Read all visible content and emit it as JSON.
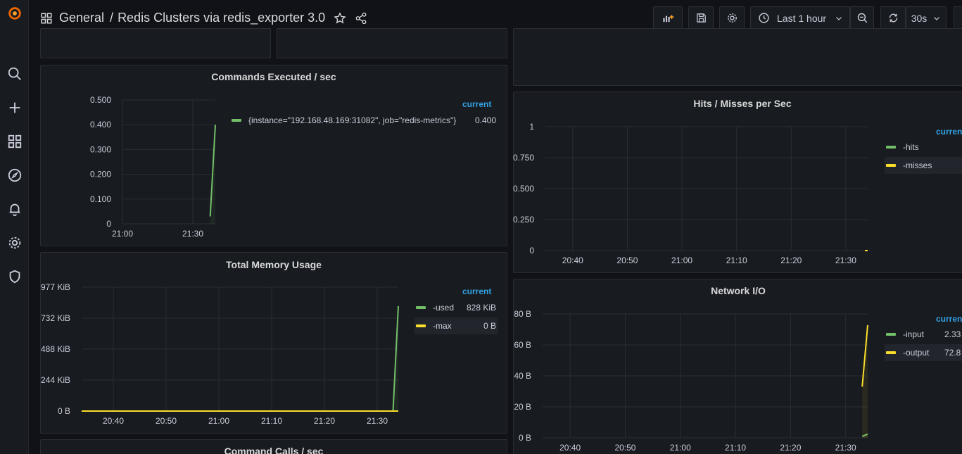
{
  "colors": {
    "green": "#73bf69",
    "yellow": "#fade2a",
    "blue": "#33a2e5",
    "background": "#111217",
    "panel": "#181b1f"
  },
  "sidebar": {
    "items": [
      {
        "name": "grafana-logo",
        "icon": "grafana-logo"
      },
      {
        "name": "search",
        "icon": "search-icon"
      },
      {
        "name": "create",
        "icon": "plus-icon"
      },
      {
        "name": "dashboards",
        "icon": "apps-icon"
      },
      {
        "name": "explore",
        "icon": "compass-icon"
      },
      {
        "name": "alerting",
        "icon": "bell-icon"
      },
      {
        "name": "configuration",
        "icon": "gear-icon"
      },
      {
        "name": "server-admin",
        "icon": "shield-icon"
      }
    ]
  },
  "header": {
    "folder": "General",
    "separator": "/",
    "title": "Redis Clusters via redis_exporter 3.0",
    "time_range": "Last 1 hour",
    "refresh": "30s"
  },
  "panels": {
    "commands": {
      "title": "Commands Executed / sec",
      "legend_header": "current",
      "legend": [
        {
          "name": "{instance=\"192.168.48.169:31082\", job=\"redis-metrics\"}",
          "value": "0.400",
          "color": "#73bf69"
        }
      ]
    },
    "memory": {
      "title": "Total Memory Usage",
      "legend_header": "current",
      "legend": [
        {
          "name": "-used",
          "value": "828 KiB",
          "color": "#73bf69"
        },
        {
          "name": "-max",
          "value": "0 B",
          "color": "#fade2a"
        }
      ]
    },
    "hits": {
      "title": "Hits / Misses per Sec",
      "legend_header": "current",
      "legend": [
        {
          "name": "-hits",
          "value": "",
          "color": "#73bf69"
        },
        {
          "name": "-misses",
          "value": "",
          "color": "#fade2a"
        }
      ]
    },
    "network": {
      "title": "Network I/O",
      "legend_header": "current",
      "legend": [
        {
          "name": "-input",
          "value": "2.33",
          "color": "#73bf69"
        },
        {
          "name": "-output",
          "value": "72.8",
          "color": "#fade2a"
        }
      ]
    },
    "command_calls": {
      "title": "Command Calls / sec"
    }
  },
  "chart_data": [
    {
      "panel": "Commands Executed / sec",
      "type": "line",
      "y_ticks": [
        "0.500",
        "0.400",
        "0.300",
        "0.200",
        "0.100",
        "0"
      ],
      "x_ticks": [
        "21:00",
        "21:30"
      ],
      "ylim": [
        0,
        0.5
      ],
      "series": [
        {
          "name": "{instance=\"192.168.48.169:31082\", job=\"redis-metrics\"}",
          "color": "#73bf69",
          "x": [
            "21:31",
            "21:34"
          ],
          "y": [
            0.03,
            0.4
          ]
        }
      ]
    },
    {
      "panel": "Total Memory Usage",
      "type": "line",
      "y_ticks": [
        "977 KiB",
        "732 KiB",
        "488 KiB",
        "244 KiB",
        "0 B"
      ],
      "x_ticks": [
        "20:40",
        "20:50",
        "21:00",
        "21:10",
        "21:20",
        "21:30"
      ],
      "ylim": [
        0,
        977
      ],
      "series": [
        {
          "name": "-used",
          "color": "#73bf69",
          "x": [
            "21:33",
            "21:34"
          ],
          "y": [
            0,
            828
          ]
        },
        {
          "name": "-max",
          "color": "#fade2a",
          "x": [
            "20:34",
            "21:34"
          ],
          "y": [
            0,
            0
          ]
        }
      ]
    },
    {
      "panel": "Hits / Misses per Sec",
      "type": "line",
      "y_ticks": [
        "1",
        "0.750",
        "0.500",
        "0.250",
        "0"
      ],
      "x_ticks": [
        "20:40",
        "20:50",
        "21:00",
        "21:10",
        "21:20",
        "21:30"
      ],
      "ylim": [
        0,
        1
      ],
      "series": [
        {
          "name": "-hits",
          "color": "#73bf69",
          "x": [
            "21:34"
          ],
          "y": [
            0
          ]
        },
        {
          "name": "-misses",
          "color": "#fade2a",
          "x": [
            "21:34"
          ],
          "y": [
            0
          ]
        }
      ]
    },
    {
      "panel": "Network I/O",
      "type": "line",
      "y_ticks": [
        "80 B",
        "60 B",
        "40 B",
        "20 B",
        "0 B"
      ],
      "x_ticks": [
        "20:40",
        "20:50",
        "21:00",
        "21:10",
        "21:20",
        "21:30"
      ],
      "ylim": [
        0,
        80
      ],
      "series": [
        {
          "name": "-input",
          "color": "#73bf69",
          "x": [
            "21:33",
            "21:34"
          ],
          "y": [
            1,
            2.33
          ]
        },
        {
          "name": "-output",
          "color": "#fade2a",
          "x": [
            "21:33",
            "21:34"
          ],
          "y": [
            33,
            72.8
          ]
        }
      ]
    }
  ]
}
